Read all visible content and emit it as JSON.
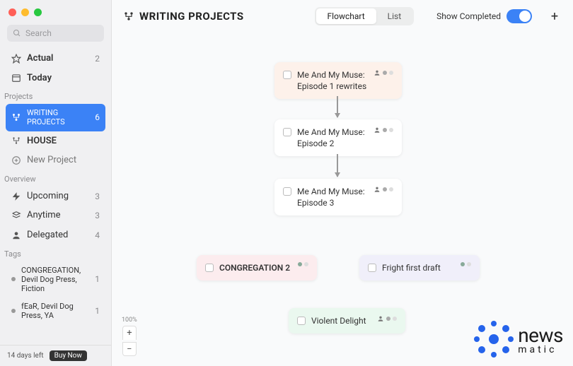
{
  "search": {
    "placeholder": "Search"
  },
  "sidebar": {
    "primary": [
      {
        "icon": "star",
        "label": "Actual",
        "count": "2"
      },
      {
        "icon": "calendar",
        "label": "Today",
        "count": ""
      }
    ],
    "projects_label": "Projects",
    "projects": [
      {
        "icon": "flow",
        "label": "WRITING PROJECTS",
        "count": "6",
        "active": true
      },
      {
        "icon": "flow",
        "label": "HOUSE",
        "count": ""
      }
    ],
    "new_project_label": "New Project",
    "overview_label": "Overview",
    "overview": [
      {
        "icon": "bolt",
        "label": "Upcoming",
        "count": "3"
      },
      {
        "icon": "stack",
        "label": "Anytime",
        "count": "3"
      },
      {
        "icon": "person",
        "label": "Delegated",
        "count": "4"
      }
    ],
    "tags_label": "Tags",
    "tags": [
      {
        "label": "CONGREGATION, Devil Dog Press, Fiction",
        "count": "1"
      },
      {
        "label": "fEaR, Devil Dog Press, YA",
        "count": "1"
      }
    ],
    "trial_text": "14 days left",
    "buy_label": "Buy Now"
  },
  "header": {
    "title": "WRITING PROJECTS",
    "tabs": {
      "flowchart": "Flowchart",
      "list": "List"
    },
    "show_completed": "Show Completed"
  },
  "cards": {
    "c1": "Me And My Muse: Episode 1 rewrites",
    "c2": "Me And My Muse: Episode 2",
    "c3": "Me And My Muse: Episode 3",
    "c4": "CONGREGATION 2",
    "c5": "Fright first draft",
    "c6": "Violent Delight"
  },
  "zoom": {
    "level": "100%"
  },
  "watermark": {
    "brand": "news",
    "sub": "matic"
  }
}
